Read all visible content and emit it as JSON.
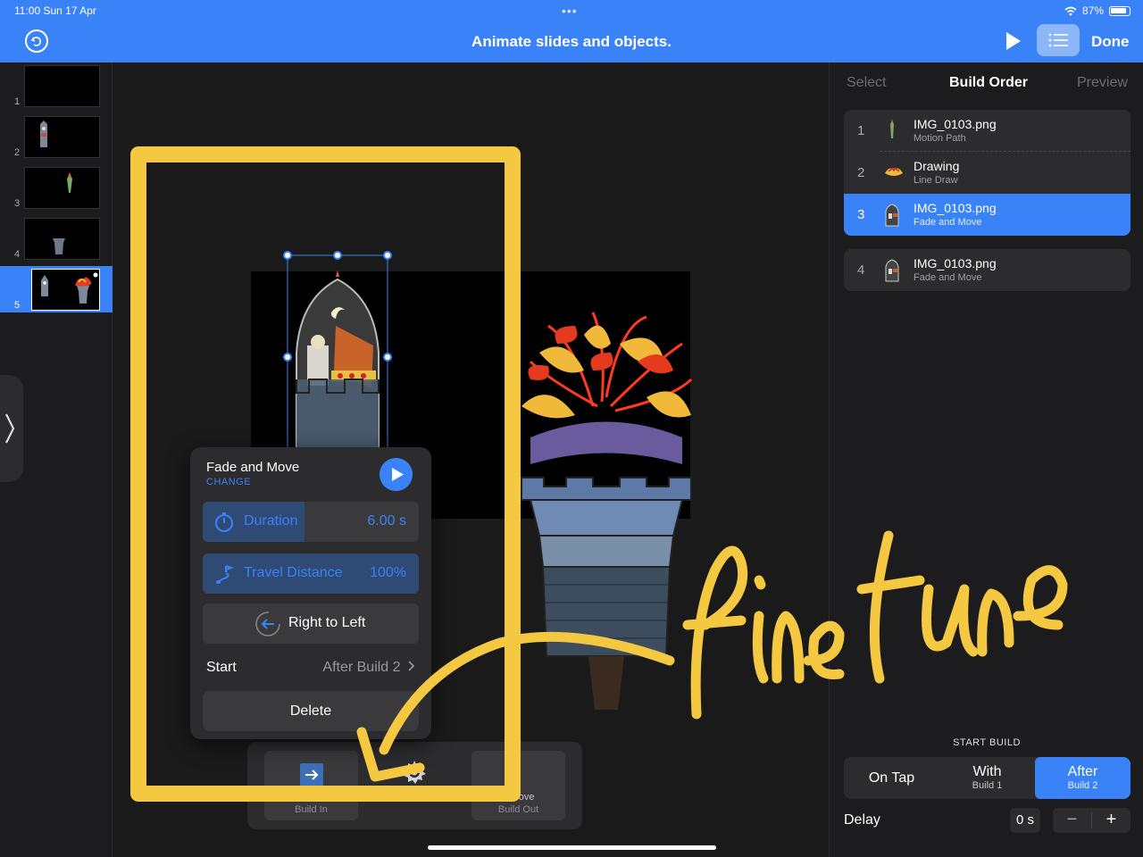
{
  "status": {
    "time": "11:00  Sun 17 Apr",
    "battery": "87%"
  },
  "toolbar": {
    "title": "Animate slides and objects.",
    "done_label": "Done"
  },
  "navigator": {
    "slides": [
      "1",
      "2",
      "3",
      "4",
      "5"
    ],
    "selected": "5"
  },
  "right_panel": {
    "tabs": [
      "Select",
      "Build Order",
      "Preview"
    ],
    "builds": [
      {
        "num": "1",
        "name": "IMG_0103.png",
        "effect": "Motion Path"
      },
      {
        "num": "2",
        "name": "Drawing",
        "effect": "Line Draw"
      },
      {
        "num": "3",
        "name": "IMG_0103.png",
        "effect": "Fade and Move"
      },
      {
        "num": "4",
        "name": "IMG_0103.png",
        "effect": "Fade and Move"
      }
    ],
    "start_build_label": "START BUILD",
    "start_options": [
      {
        "main": "On Tap",
        "sub": ""
      },
      {
        "main": "With",
        "sub": "Build 1"
      },
      {
        "main": "After",
        "sub": "Build 2"
      }
    ],
    "delay_label": "Delay",
    "delay_value": "0 s",
    "stepper_minus": "−",
    "stepper_plus": "+"
  },
  "popover": {
    "title": "Fade and Move",
    "change": "CHANGE",
    "duration_label": "Duration",
    "duration_value": "6.00 s",
    "duration_progress": 0.47,
    "travel_label": "Travel Distance",
    "travel_value": "100%",
    "direction_label": "Right to Left",
    "start_label": "Start",
    "start_value": "After Build 2",
    "delete_label": "Delete"
  },
  "tray": {
    "build_in_label": "Build In",
    "build_out_top": "d Move",
    "build_out_label": "Build Out"
  },
  "annotation": {
    "text": "fine tune",
    "color": "#f5c842"
  },
  "colors": {
    "accent": "#3a82f7",
    "background": "#1c1c1e",
    "annotation": "#f5c842"
  }
}
